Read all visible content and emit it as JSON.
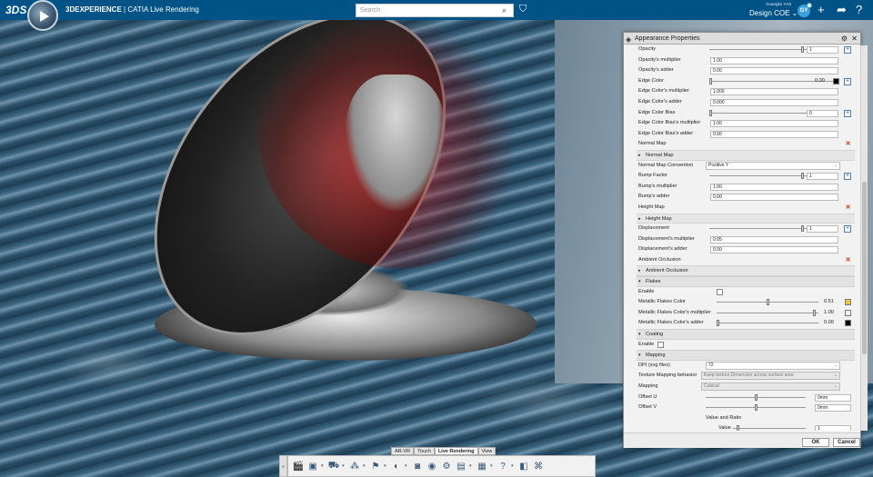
{
  "header": {
    "brand_logo": "3DS",
    "app_name_bold": "3DEXPERIENCE",
    "app_name_rest": " | CATIA Live Rendering",
    "search_placeholder": "Search",
    "user_name": "Guangke YAN",
    "role": "Design COE ⌄",
    "avatar_initials": "GY",
    "icons": [
      "search-icon",
      "tag-icon",
      "add-icon",
      "share-icon",
      "help-icon"
    ]
  },
  "toolbar": {
    "tabs": [
      "AR-VR",
      "Touch",
      "Live Rendering",
      "View"
    ],
    "active_tab": "Live Rendering"
  },
  "panel": {
    "title": "Appearance Properties",
    "rows": [
      {
        "type": "slider",
        "label": "Opacity",
        "value": "1",
        "pos": 0.93,
        "plus": true
      },
      {
        "type": "input",
        "label": "Opacity's multiplier",
        "value": "1.00"
      },
      {
        "type": "input",
        "label": "Opacity's adder",
        "value": "0.00"
      },
      {
        "type": "color",
        "label": "Edge Color",
        "value": "0.00",
        "pos": 0.0,
        "color": "#000000",
        "plus": true
      },
      {
        "type": "input",
        "label": "Edge Color's multiplier",
        "value": "1.000"
      },
      {
        "type": "input",
        "label": "Edge Color's adder",
        "value": "0.000"
      },
      {
        "type": "slider",
        "label": "Edge Color Bias",
        "value": "0",
        "pos": 0.0,
        "plus": true
      },
      {
        "type": "input",
        "label": "Edge Color Bias's multiplier",
        "value": "1.00"
      },
      {
        "type": "input",
        "label": "Edge Color Bias's adder",
        "value": "0.00"
      },
      {
        "type": "map",
        "label": "Normal Map"
      },
      {
        "type": "sub",
        "label": "Normal Map"
      },
      {
        "type": "dropdown",
        "label": "Normal Map Convention",
        "value": "Positive Y"
      },
      {
        "type": "slider",
        "label": "Bump Factor",
        "value": "1",
        "pos": 0.93,
        "plus": true
      },
      {
        "type": "input",
        "label": "Bump's multiplier",
        "value": "1.00"
      },
      {
        "type": "input",
        "label": "Bump's adder",
        "value": "0.00"
      },
      {
        "type": "map",
        "label": "Height Map"
      },
      {
        "type": "sub",
        "label": "Height Map"
      },
      {
        "type": "slider",
        "label": "Displacement",
        "value": "1",
        "pos": 0.93,
        "plus": true
      },
      {
        "type": "input",
        "label": "Displacement's multiplier",
        "value": "0.05"
      },
      {
        "type": "input",
        "label": "Displacement's adder",
        "value": "0.00"
      },
      {
        "type": "map",
        "label": "Ambient Occlusion"
      },
      {
        "type": "sub",
        "label": "Ambient Occlusion"
      },
      {
        "type": "section",
        "label": "Flakes"
      },
      {
        "type": "check",
        "label": "Enable"
      },
      {
        "type": "flake",
        "label": "Metallic Flakes Color",
        "value": "0.51",
        "pos": 0.5,
        "color": "#e8c93a"
      },
      {
        "type": "flake",
        "label": "Metallic Flakes Color's multiplier",
        "value": "1.00",
        "pos": 0.97,
        "color": "#f0f0f0"
      },
      {
        "type": "flake",
        "label": "Metallic Flakes Color's adder",
        "value": "0.00",
        "pos": 0.0,
        "color": "#000000"
      },
      {
        "type": "section",
        "label": "Coating"
      },
      {
        "type": "check",
        "label": "Enable"
      },
      {
        "type": "section",
        "label": "Mapping"
      },
      {
        "type": "dropdown",
        "label": "DPI (svg files)",
        "value": "72"
      },
      {
        "type": "dropdown_dis",
        "label": "Texture Mapping behavior",
        "value": "Keep texture Dimension across surface area"
      },
      {
        "type": "dropdown_dis",
        "label": "Mapping",
        "value": "Cubical"
      },
      {
        "type": "offset",
        "label": "Offset U",
        "value": "0mm",
        "pos": 0.5
      },
      {
        "type": "offset",
        "label": "Offset V",
        "value": "0mm",
        "pos": 0.5
      },
      {
        "type": "plain",
        "label": "Value and Ratio"
      },
      {
        "type": "ratio",
        "label": "Value",
        "value": "1",
        "pos": 0.05
      }
    ],
    "ok_label": "OK",
    "cancel_label": "Cancel"
  }
}
